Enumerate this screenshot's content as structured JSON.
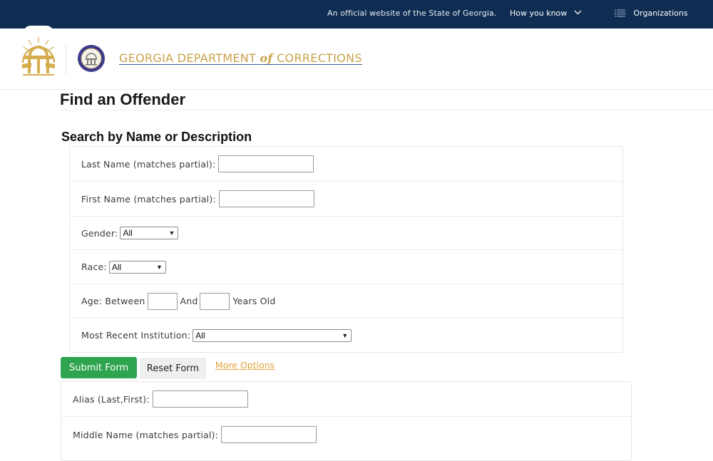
{
  "topbar": {
    "official_text": "An official website of the State of Georgia.",
    "how_you_know_label": "How you know",
    "organizations_label": "Organizations"
  },
  "header": {
    "brand_prefix": "GEORGIA DEPARTMENT ",
    "brand_of": "of",
    "brand_suffix": " CORRECTIONS",
    "colors": {
      "topbar_bg": "#0f2d52",
      "brand_gold": "#c9a24a",
      "submit_green": "#2ea44f",
      "link_orange": "#e0a43b"
    }
  },
  "page": {
    "title": "Find an Offender",
    "section_title": "Search by Name or Description"
  },
  "form": {
    "last_name": {
      "label": "Last Name (matches partial):",
      "value": ""
    },
    "first_name": {
      "label": "First Name (matches partial):",
      "value": ""
    },
    "gender": {
      "label": "Gender:",
      "selected": "All"
    },
    "race": {
      "label": "Race:",
      "selected": "All"
    },
    "age": {
      "label_prefix": "Age: Between",
      "label_and": "And",
      "label_suffix": "Years Old",
      "min": "",
      "max": ""
    },
    "institution": {
      "label": "Most Recent Institution:",
      "selected": "All"
    },
    "submit_label": "Submit Form",
    "reset_label": "Reset Form",
    "more_options_label": "More Options"
  },
  "more_options": {
    "alias": {
      "label": "Alias (Last,First):",
      "value": ""
    },
    "middle_name": {
      "label": "Middle Name (matches partial):",
      "value": ""
    }
  }
}
